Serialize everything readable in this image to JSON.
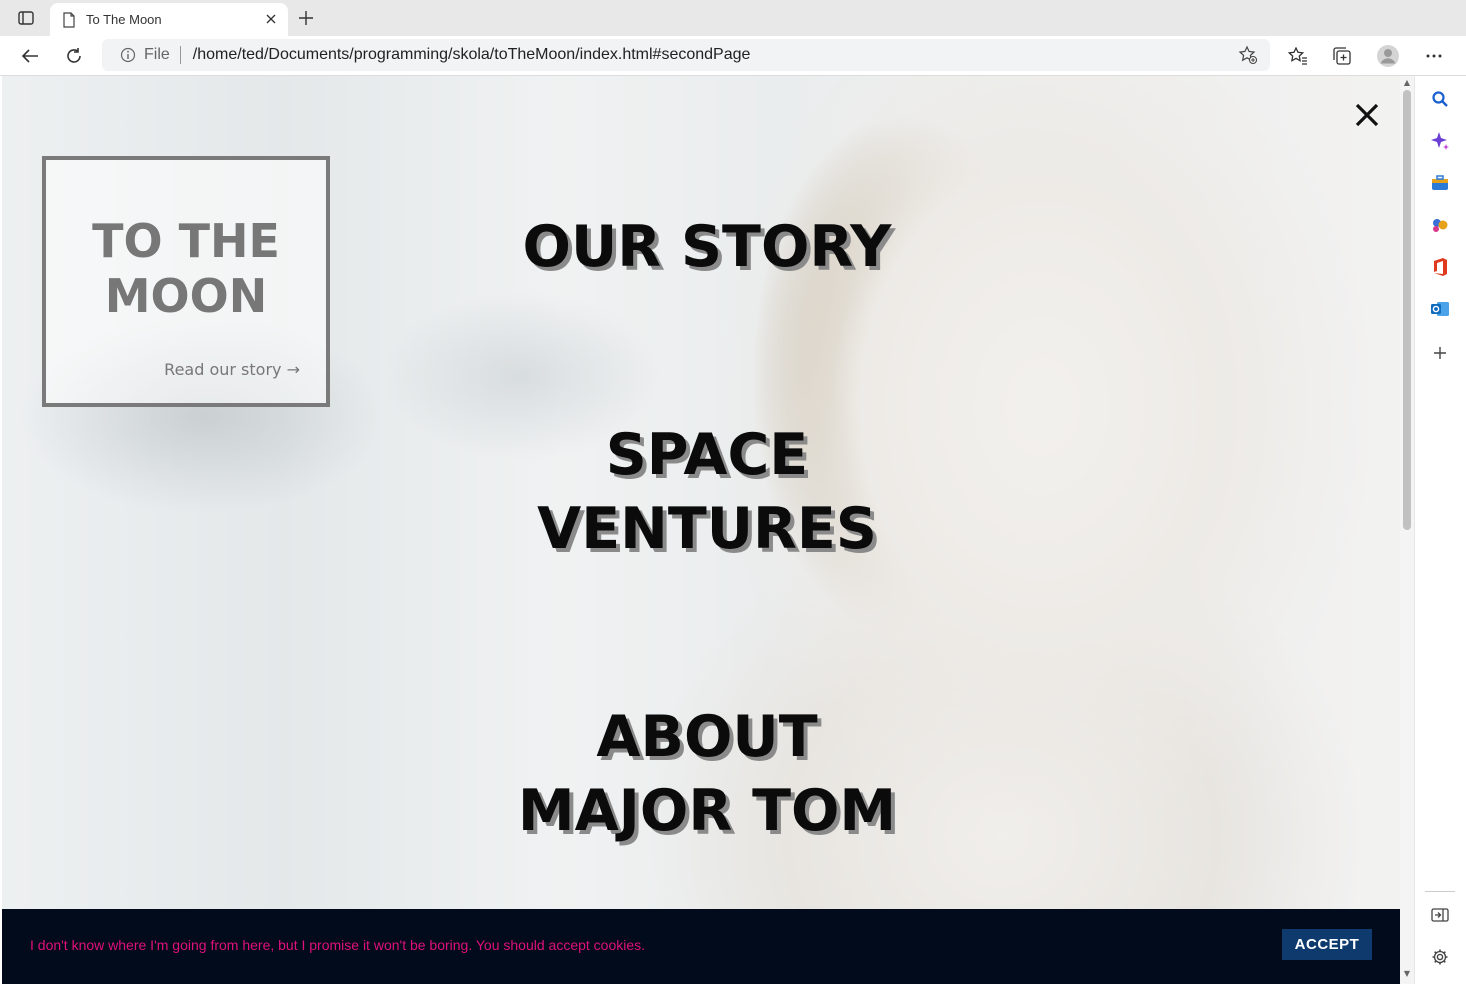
{
  "browser": {
    "tab_title": "To The Moon",
    "address_prefix": "File",
    "address_url": "/home/ted/Documents/programming/skola/toTheMoon/index.html#secondPage"
  },
  "brand": {
    "title_line1": "TO THE",
    "title_line2": "MOON",
    "read_story": "Read our story →"
  },
  "menu": {
    "items": [
      {
        "line1": "OUR STORY",
        "line2": ""
      },
      {
        "line1": "SPACE",
        "line2": "VENTURES"
      },
      {
        "line1": "ABOUT",
        "line2": "MAJOR TOM"
      }
    ]
  },
  "cookie": {
    "message": "I don't know where I'm going from here, but I promise it won't be boring. You should accept cookies.",
    "accept_label": "ACCEPT"
  },
  "colors": {
    "cookie_bg": "#020b1c",
    "cookie_text": "#e0107a",
    "accept_bg": "#0f3a6e"
  }
}
